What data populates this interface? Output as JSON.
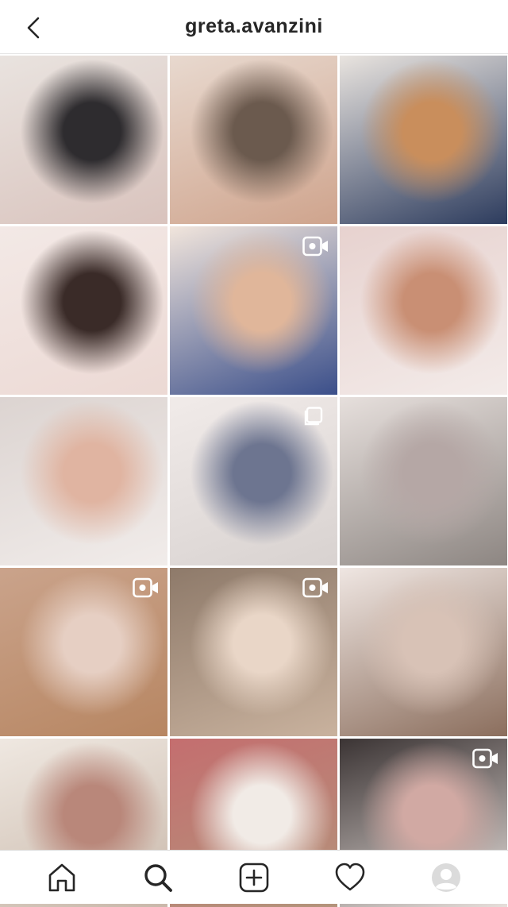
{
  "header": {
    "username": "greta.avanzini",
    "back_icon": "chevron-left-icon"
  },
  "grid": {
    "posts": [
      {
        "id": 1,
        "type": "photo",
        "colors": [
          "#d9c3bd",
          "#2e2c2f",
          "#e9e3df"
        ]
      },
      {
        "id": 2,
        "type": "photo",
        "colors": [
          "#cfa48d",
          "#6b5a4e",
          "#e8d9cf"
        ]
      },
      {
        "id": 3,
        "type": "photo",
        "colors": [
          "#2d3c5e",
          "#c98e5c",
          "#e9e4df"
        ]
      },
      {
        "id": 4,
        "type": "photo",
        "colors": [
          "#ecd9d4",
          "#3a2b28",
          "#f3e9e6"
        ]
      },
      {
        "id": 5,
        "type": "video",
        "colors": [
          "#3b4f8a",
          "#e0b69a",
          "#f1e5dc"
        ]
      },
      {
        "id": 6,
        "type": "photo",
        "colors": [
          "#f3ebe9",
          "#c98f74",
          "#e7d2cf"
        ]
      },
      {
        "id": 7,
        "type": "photo",
        "colors": [
          "#f1ecea",
          "#e0b4a1",
          "#dcd4d1"
        ]
      },
      {
        "id": 8,
        "type": "carousel",
        "colors": [
          "#d8d2d0",
          "#6d7590",
          "#f1ebe9"
        ]
      },
      {
        "id": 9,
        "type": "photo",
        "colors": [
          "#8d8682",
          "#b5a7a5",
          "#e6dfdc"
        ]
      },
      {
        "id": 10,
        "type": "video",
        "colors": [
          "#b78662",
          "#e6cfc3",
          "#caa38b"
        ]
      },
      {
        "id": 11,
        "type": "video",
        "colors": [
          "#c9b29e",
          "#e9d6c7",
          "#8e7a6a"
        ]
      },
      {
        "id": 12,
        "type": "photo",
        "colors": [
          "#8b6e5d",
          "#d8c2b6",
          "#efe6e2"
        ]
      },
      {
        "id": 13,
        "type": "photo",
        "colors": [
          "#c9b8aa",
          "#b9877a",
          "#efe8e1"
        ]
      },
      {
        "id": 14,
        "type": "photo",
        "colors": [
          "#b3947b",
          "#f1ebe6",
          "#c46e6f"
        ]
      },
      {
        "id": 15,
        "type": "video",
        "colors": [
          "#e7dfdb",
          "#d1a9a3",
          "#3b3434"
        ]
      }
    ]
  },
  "tabbar": {
    "items": [
      {
        "name": "home",
        "icon": "home-icon"
      },
      {
        "name": "search",
        "icon": "search-icon",
        "active": true
      },
      {
        "name": "new-post",
        "icon": "plus-square-icon"
      },
      {
        "name": "activity",
        "icon": "heart-icon"
      },
      {
        "name": "profile",
        "icon": "profile-avatar-icon"
      }
    ]
  }
}
